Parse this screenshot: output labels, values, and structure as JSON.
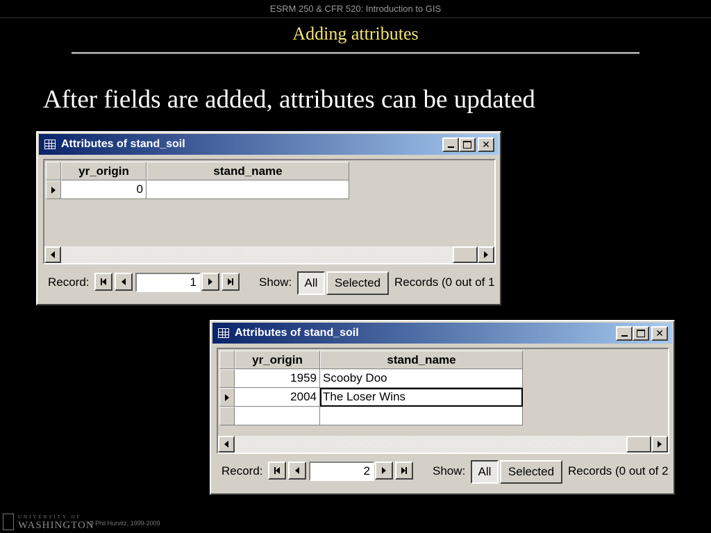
{
  "slide": {
    "course": "ESRM 250 & CFR 520: Introduction to GIS",
    "title": "Adding attributes",
    "headline": "After fields are added, attributes can be updated",
    "footer_university_small": "UNIVERSITY OF",
    "footer_university": "WASHINGTON",
    "footer_copyright": "© Phil Hurvitz, 1999-2009"
  },
  "windows": [
    {
      "title": "Attributes of stand_soil",
      "columns": [
        "yr_origin",
        "stand_name"
      ],
      "rows": [
        {
          "yr_origin": "0",
          "stand_name": ""
        }
      ],
      "nav": {
        "record_label": "Record:",
        "record_value": "1",
        "show_label": "Show:",
        "all_label": "All",
        "selected_label": "Selected",
        "records_text": "Records  (0 out of 1"
      }
    },
    {
      "title": "Attributes of stand_soil",
      "columns": [
        "yr_origin",
        "stand_name"
      ],
      "rows": [
        {
          "yr_origin": "1959",
          "stand_name": "Scooby Doo"
        },
        {
          "yr_origin": "2004",
          "stand_name": "The Loser Wins"
        },
        {
          "yr_origin": "",
          "stand_name": ""
        }
      ],
      "nav": {
        "record_label": "Record:",
        "record_value": "2",
        "show_label": "Show:",
        "all_label": "All",
        "selected_label": "Selected",
        "records_text": "Records  (0 out of 2"
      }
    }
  ],
  "icons": {
    "table": "table-icon",
    "minimize": "minimize-icon",
    "maximize": "maximize-icon",
    "close": "close-icon",
    "row_pointer": "current-row-arrow-icon"
  },
  "colors": {
    "background": "#000000",
    "title": "#f3e579",
    "titlebar_start": "#0a246a",
    "titlebar_end": "#a6caf0",
    "window_face": "#d4d0c8"
  }
}
